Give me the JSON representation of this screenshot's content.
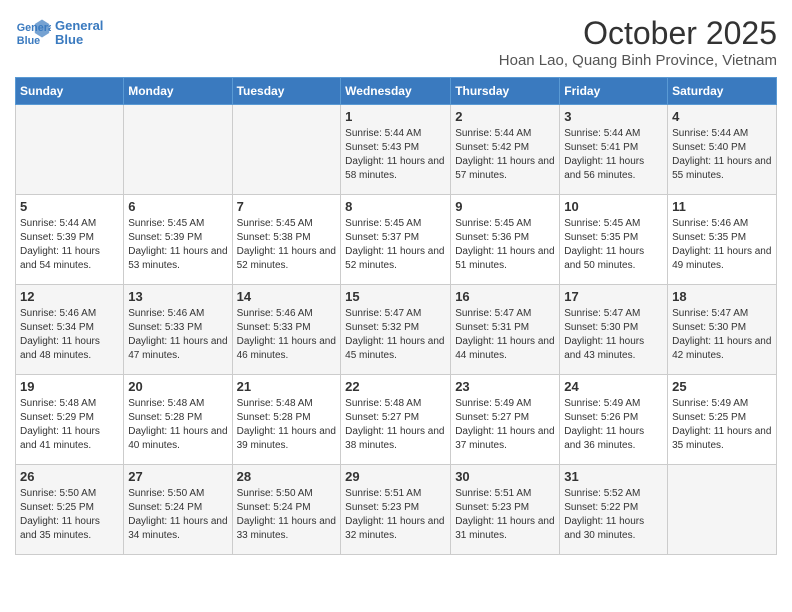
{
  "logo": {
    "line1": "General",
    "line2": "Blue"
  },
  "title": "October 2025",
  "subtitle": "Hoan Lao, Quang Binh Province, Vietnam",
  "days_of_week": [
    "Sunday",
    "Monday",
    "Tuesday",
    "Wednesday",
    "Thursday",
    "Friday",
    "Saturday"
  ],
  "weeks": [
    [
      {
        "day": "",
        "sunrise": "",
        "sunset": "",
        "daylight": ""
      },
      {
        "day": "",
        "sunrise": "",
        "sunset": "",
        "daylight": ""
      },
      {
        "day": "",
        "sunrise": "",
        "sunset": "",
        "daylight": ""
      },
      {
        "day": "1",
        "sunrise": "Sunrise: 5:44 AM",
        "sunset": "Sunset: 5:43 PM",
        "daylight": "Daylight: 11 hours and 58 minutes."
      },
      {
        "day": "2",
        "sunrise": "Sunrise: 5:44 AM",
        "sunset": "Sunset: 5:42 PM",
        "daylight": "Daylight: 11 hours and 57 minutes."
      },
      {
        "day": "3",
        "sunrise": "Sunrise: 5:44 AM",
        "sunset": "Sunset: 5:41 PM",
        "daylight": "Daylight: 11 hours and 56 minutes."
      },
      {
        "day": "4",
        "sunrise": "Sunrise: 5:44 AM",
        "sunset": "Sunset: 5:40 PM",
        "daylight": "Daylight: 11 hours and 55 minutes."
      }
    ],
    [
      {
        "day": "5",
        "sunrise": "Sunrise: 5:44 AM",
        "sunset": "Sunset: 5:39 PM",
        "daylight": "Daylight: 11 hours and 54 minutes."
      },
      {
        "day": "6",
        "sunrise": "Sunrise: 5:45 AM",
        "sunset": "Sunset: 5:39 PM",
        "daylight": "Daylight: 11 hours and 53 minutes."
      },
      {
        "day": "7",
        "sunrise": "Sunrise: 5:45 AM",
        "sunset": "Sunset: 5:38 PM",
        "daylight": "Daylight: 11 hours and 52 minutes."
      },
      {
        "day": "8",
        "sunrise": "Sunrise: 5:45 AM",
        "sunset": "Sunset: 5:37 PM",
        "daylight": "Daylight: 11 hours and 52 minutes."
      },
      {
        "day": "9",
        "sunrise": "Sunrise: 5:45 AM",
        "sunset": "Sunset: 5:36 PM",
        "daylight": "Daylight: 11 hours and 51 minutes."
      },
      {
        "day": "10",
        "sunrise": "Sunrise: 5:45 AM",
        "sunset": "Sunset: 5:35 PM",
        "daylight": "Daylight: 11 hours and 50 minutes."
      },
      {
        "day": "11",
        "sunrise": "Sunrise: 5:46 AM",
        "sunset": "Sunset: 5:35 PM",
        "daylight": "Daylight: 11 hours and 49 minutes."
      }
    ],
    [
      {
        "day": "12",
        "sunrise": "Sunrise: 5:46 AM",
        "sunset": "Sunset: 5:34 PM",
        "daylight": "Daylight: 11 hours and 48 minutes."
      },
      {
        "day": "13",
        "sunrise": "Sunrise: 5:46 AM",
        "sunset": "Sunset: 5:33 PM",
        "daylight": "Daylight: 11 hours and 47 minutes."
      },
      {
        "day": "14",
        "sunrise": "Sunrise: 5:46 AM",
        "sunset": "Sunset: 5:33 PM",
        "daylight": "Daylight: 11 hours and 46 minutes."
      },
      {
        "day": "15",
        "sunrise": "Sunrise: 5:47 AM",
        "sunset": "Sunset: 5:32 PM",
        "daylight": "Daylight: 11 hours and 45 minutes."
      },
      {
        "day": "16",
        "sunrise": "Sunrise: 5:47 AM",
        "sunset": "Sunset: 5:31 PM",
        "daylight": "Daylight: 11 hours and 44 minutes."
      },
      {
        "day": "17",
        "sunrise": "Sunrise: 5:47 AM",
        "sunset": "Sunset: 5:30 PM",
        "daylight": "Daylight: 11 hours and 43 minutes."
      },
      {
        "day": "18",
        "sunrise": "Sunrise: 5:47 AM",
        "sunset": "Sunset: 5:30 PM",
        "daylight": "Daylight: 11 hours and 42 minutes."
      }
    ],
    [
      {
        "day": "19",
        "sunrise": "Sunrise: 5:48 AM",
        "sunset": "Sunset: 5:29 PM",
        "daylight": "Daylight: 11 hours and 41 minutes."
      },
      {
        "day": "20",
        "sunrise": "Sunrise: 5:48 AM",
        "sunset": "Sunset: 5:28 PM",
        "daylight": "Daylight: 11 hours and 40 minutes."
      },
      {
        "day": "21",
        "sunrise": "Sunrise: 5:48 AM",
        "sunset": "Sunset: 5:28 PM",
        "daylight": "Daylight: 11 hours and 39 minutes."
      },
      {
        "day": "22",
        "sunrise": "Sunrise: 5:48 AM",
        "sunset": "Sunset: 5:27 PM",
        "daylight": "Daylight: 11 hours and 38 minutes."
      },
      {
        "day": "23",
        "sunrise": "Sunrise: 5:49 AM",
        "sunset": "Sunset: 5:27 PM",
        "daylight": "Daylight: 11 hours and 37 minutes."
      },
      {
        "day": "24",
        "sunrise": "Sunrise: 5:49 AM",
        "sunset": "Sunset: 5:26 PM",
        "daylight": "Daylight: 11 hours and 36 minutes."
      },
      {
        "day": "25",
        "sunrise": "Sunrise: 5:49 AM",
        "sunset": "Sunset: 5:25 PM",
        "daylight": "Daylight: 11 hours and 35 minutes."
      }
    ],
    [
      {
        "day": "26",
        "sunrise": "Sunrise: 5:50 AM",
        "sunset": "Sunset: 5:25 PM",
        "daylight": "Daylight: 11 hours and 35 minutes."
      },
      {
        "day": "27",
        "sunrise": "Sunrise: 5:50 AM",
        "sunset": "Sunset: 5:24 PM",
        "daylight": "Daylight: 11 hours and 34 minutes."
      },
      {
        "day": "28",
        "sunrise": "Sunrise: 5:50 AM",
        "sunset": "Sunset: 5:24 PM",
        "daylight": "Daylight: 11 hours and 33 minutes."
      },
      {
        "day": "29",
        "sunrise": "Sunrise: 5:51 AM",
        "sunset": "Sunset: 5:23 PM",
        "daylight": "Daylight: 11 hours and 32 minutes."
      },
      {
        "day": "30",
        "sunrise": "Sunrise: 5:51 AM",
        "sunset": "Sunset: 5:23 PM",
        "daylight": "Daylight: 11 hours and 31 minutes."
      },
      {
        "day": "31",
        "sunrise": "Sunrise: 5:52 AM",
        "sunset": "Sunset: 5:22 PM",
        "daylight": "Daylight: 11 hours and 30 minutes."
      },
      {
        "day": "",
        "sunrise": "",
        "sunset": "",
        "daylight": ""
      }
    ]
  ]
}
